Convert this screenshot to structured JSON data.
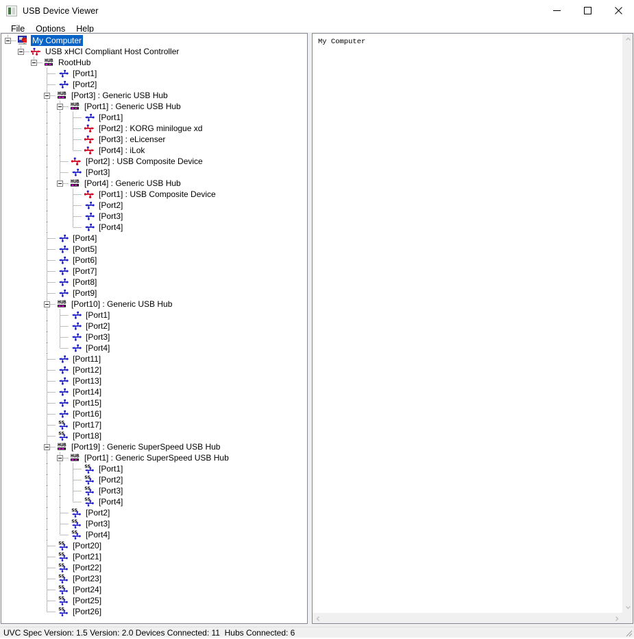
{
  "window": {
    "title": "USB Device Viewer",
    "icon": "usb-viewer-icon",
    "minimize_label": "Minimize",
    "maximize_label": "Maximize",
    "close_label": "Close"
  },
  "menu": {
    "items": [
      {
        "label": "File"
      },
      {
        "label": "Options"
      },
      {
        "label": "Help"
      }
    ]
  },
  "details_pane": {
    "text": "My Computer"
  },
  "status": {
    "text": "UVC Spec Version: 1.5 Version: 2.0 Devices Connected: 11  Hubs Connected: 6",
    "uvc_spec_version": "1.5",
    "version": "2.0",
    "devices_connected": "11",
    "hubs_connected": "6"
  },
  "colors": {
    "selection": "#0a64c8",
    "hub_accent": "#e000e0",
    "device_icon": "#d00020",
    "empty_port_icon": "#1a1ac8",
    "superspeed_icon": "#1a1ac8",
    "tree_line": "#808080"
  },
  "tree": {
    "nodes": [
      {
        "id": 0,
        "depth": 0,
        "icon": "my-computer-icon",
        "label": "My Computer",
        "expander": "expanded",
        "selected": true
      },
      {
        "id": 1,
        "depth": 1,
        "icon": "host-controller-icon",
        "label": "USB xHCI Compliant Host Controller",
        "expander": "expanded",
        "selected": false
      },
      {
        "id": 2,
        "depth": 2,
        "icon": "hub-icon",
        "label": "RootHub",
        "expander": "expanded",
        "selected": false
      },
      {
        "id": 3,
        "depth": 3,
        "icon": "empty-port-icon",
        "label": "[Port1]",
        "expander": "none",
        "selected": false
      },
      {
        "id": 4,
        "depth": 3,
        "icon": "empty-port-icon",
        "label": "[Port2]",
        "expander": "none",
        "selected": false
      },
      {
        "id": 5,
        "depth": 3,
        "icon": "hub-icon",
        "label": "[Port3]  :  Generic USB Hub",
        "expander": "expanded",
        "selected": false
      },
      {
        "id": 6,
        "depth": 4,
        "icon": "hub-icon",
        "label": "[Port1]  :  Generic USB Hub",
        "expander": "expanded",
        "selected": false
      },
      {
        "id": 7,
        "depth": 5,
        "icon": "empty-port-icon",
        "label": "[Port1]",
        "expander": "none",
        "selected": false
      },
      {
        "id": 8,
        "depth": 5,
        "icon": "device-icon",
        "label": "[Port2]  :  KORG minilogue xd",
        "expander": "none",
        "selected": false
      },
      {
        "id": 9,
        "depth": 5,
        "icon": "device-icon",
        "label": "[Port3]  :  eLicenser",
        "expander": "none",
        "selected": false
      },
      {
        "id": 10,
        "depth": 5,
        "icon": "device-icon",
        "label": "[Port4]  :  iLok",
        "expander": "none",
        "selected": false
      },
      {
        "id": 11,
        "depth": 4,
        "icon": "device-icon",
        "label": "[Port2]  :  USB Composite Device",
        "expander": "none",
        "selected": false
      },
      {
        "id": 12,
        "depth": 4,
        "icon": "empty-port-icon",
        "label": "[Port3]",
        "expander": "none",
        "selected": false
      },
      {
        "id": 13,
        "depth": 4,
        "icon": "hub-icon",
        "label": "[Port4]  :  Generic USB Hub",
        "expander": "expanded",
        "selected": false
      },
      {
        "id": 14,
        "depth": 5,
        "icon": "device-icon",
        "label": "[Port1]  :  USB Composite Device",
        "expander": "none",
        "selected": false
      },
      {
        "id": 15,
        "depth": 5,
        "icon": "empty-port-icon",
        "label": "[Port2]",
        "expander": "none",
        "selected": false
      },
      {
        "id": 16,
        "depth": 5,
        "icon": "empty-port-icon",
        "label": "[Port3]",
        "expander": "none",
        "selected": false
      },
      {
        "id": 17,
        "depth": 5,
        "icon": "empty-port-icon",
        "label": "[Port4]",
        "expander": "none",
        "selected": false
      },
      {
        "id": 18,
        "depth": 3,
        "icon": "empty-port-icon",
        "label": "[Port4]",
        "expander": "none",
        "selected": false
      },
      {
        "id": 19,
        "depth": 3,
        "icon": "empty-port-icon",
        "label": "[Port5]",
        "expander": "none",
        "selected": false
      },
      {
        "id": 20,
        "depth": 3,
        "icon": "empty-port-icon",
        "label": "[Port6]",
        "expander": "none",
        "selected": false
      },
      {
        "id": 21,
        "depth": 3,
        "icon": "empty-port-icon",
        "label": "[Port7]",
        "expander": "none",
        "selected": false
      },
      {
        "id": 22,
        "depth": 3,
        "icon": "empty-port-icon",
        "label": "[Port8]",
        "expander": "none",
        "selected": false
      },
      {
        "id": 23,
        "depth": 3,
        "icon": "empty-port-icon",
        "label": "[Port9]",
        "expander": "none",
        "selected": false
      },
      {
        "id": 24,
        "depth": 3,
        "icon": "hub-icon",
        "label": "[Port10]  :  Generic USB Hub",
        "expander": "expanded",
        "selected": false
      },
      {
        "id": 25,
        "depth": 4,
        "icon": "empty-port-icon",
        "label": "[Port1]",
        "expander": "none",
        "selected": false
      },
      {
        "id": 26,
        "depth": 4,
        "icon": "empty-port-icon",
        "label": "[Port2]",
        "expander": "none",
        "selected": false
      },
      {
        "id": 27,
        "depth": 4,
        "icon": "empty-port-icon",
        "label": "[Port3]",
        "expander": "none",
        "selected": false
      },
      {
        "id": 28,
        "depth": 4,
        "icon": "empty-port-icon",
        "label": "[Port4]",
        "expander": "none",
        "selected": false
      },
      {
        "id": 29,
        "depth": 3,
        "icon": "empty-port-icon",
        "label": "[Port11]",
        "expander": "none",
        "selected": false
      },
      {
        "id": 30,
        "depth": 3,
        "icon": "empty-port-icon",
        "label": "[Port12]",
        "expander": "none",
        "selected": false
      },
      {
        "id": 31,
        "depth": 3,
        "icon": "empty-port-icon",
        "label": "[Port13]",
        "expander": "none",
        "selected": false
      },
      {
        "id": 32,
        "depth": 3,
        "icon": "empty-port-icon",
        "label": "[Port14]",
        "expander": "none",
        "selected": false
      },
      {
        "id": 33,
        "depth": 3,
        "icon": "empty-port-icon",
        "label": "[Port15]",
        "expander": "none",
        "selected": false
      },
      {
        "id": 34,
        "depth": 3,
        "icon": "empty-port-icon",
        "label": "[Port16]",
        "expander": "none",
        "selected": false
      },
      {
        "id": 35,
        "depth": 3,
        "icon": "superspeed-port-icon",
        "label": "[Port17]",
        "expander": "none",
        "selected": false
      },
      {
        "id": 36,
        "depth": 3,
        "icon": "superspeed-port-icon",
        "label": "[Port18]",
        "expander": "none",
        "selected": false
      },
      {
        "id": 37,
        "depth": 3,
        "icon": "hub-icon",
        "label": "[Port19]  :  Generic SuperSpeed USB Hub",
        "expander": "expanded",
        "selected": false
      },
      {
        "id": 38,
        "depth": 4,
        "icon": "hub-icon",
        "label": "[Port1]  :  Generic SuperSpeed USB Hub",
        "expander": "expanded",
        "selected": false
      },
      {
        "id": 39,
        "depth": 5,
        "icon": "superspeed-port-icon",
        "label": "[Port1]",
        "expander": "none",
        "selected": false
      },
      {
        "id": 40,
        "depth": 5,
        "icon": "superspeed-port-icon",
        "label": "[Port2]",
        "expander": "none",
        "selected": false
      },
      {
        "id": 41,
        "depth": 5,
        "icon": "superspeed-port-icon",
        "label": "[Port3]",
        "expander": "none",
        "selected": false
      },
      {
        "id": 42,
        "depth": 5,
        "icon": "superspeed-port-icon",
        "label": "[Port4]",
        "expander": "none",
        "selected": false
      },
      {
        "id": 43,
        "depth": 4,
        "icon": "superspeed-port-icon",
        "label": "[Port2]",
        "expander": "none",
        "selected": false
      },
      {
        "id": 44,
        "depth": 4,
        "icon": "superspeed-port-icon",
        "label": "[Port3]",
        "expander": "none",
        "selected": false
      },
      {
        "id": 45,
        "depth": 4,
        "icon": "superspeed-port-icon",
        "label": "[Port4]",
        "expander": "none",
        "selected": false
      },
      {
        "id": 46,
        "depth": 3,
        "icon": "superspeed-port-icon",
        "label": "[Port20]",
        "expander": "none",
        "selected": false
      },
      {
        "id": 47,
        "depth": 3,
        "icon": "superspeed-port-icon",
        "label": "[Port21]",
        "expander": "none",
        "selected": false
      },
      {
        "id": 48,
        "depth": 3,
        "icon": "superspeed-port-icon",
        "label": "[Port22]",
        "expander": "none",
        "selected": false
      },
      {
        "id": 49,
        "depth": 3,
        "icon": "superspeed-port-icon",
        "label": "[Port23]",
        "expander": "none",
        "selected": false
      },
      {
        "id": 50,
        "depth": 3,
        "icon": "superspeed-port-icon",
        "label": "[Port24]",
        "expander": "none",
        "selected": false
      },
      {
        "id": 51,
        "depth": 3,
        "icon": "superspeed-port-icon",
        "label": "[Port25]",
        "expander": "none",
        "selected": false
      },
      {
        "id": 52,
        "depth": 3,
        "icon": "superspeed-port-icon",
        "label": "[Port26]",
        "expander": "none",
        "selected": false
      }
    ]
  }
}
